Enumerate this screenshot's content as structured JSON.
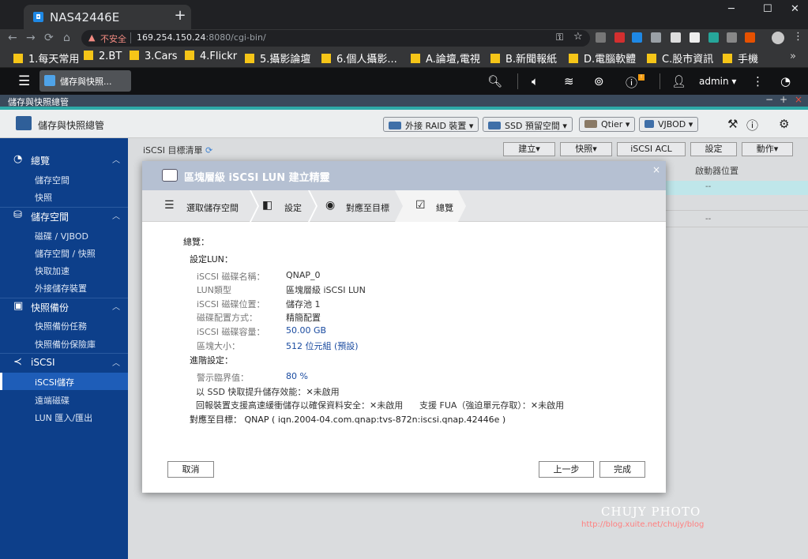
{
  "browser": {
    "tab_title": "NAS42446E",
    "tab_close": "×",
    "new_tab": "+",
    "window_controls": [
      "─",
      "☐",
      "✕"
    ],
    "insecure_label": "不安全",
    "url_host": "169.254.150.24",
    "url_rest": ":8080/cgi-bin/",
    "bookmarks": [
      "1.每天常用",
      "2.BT",
      "3.Cars",
      "4.Flickr",
      "5.攝影論壇",
      "6.個人攝影...",
      "A.論壇,電視",
      "B.新聞報紙",
      "D.電腦軟體",
      "C.股市資訊",
      "手機"
    ],
    "more": "»"
  },
  "qts": {
    "app_tab": "儲存與快照...",
    "info_badge": "!",
    "user": "admin"
  },
  "app": {
    "window_title": "儲存與快照總管",
    "title": "儲存與快照總管",
    "window_ctrls": [
      "−",
      "+",
      "×"
    ],
    "header_buttons": [
      "外接 RAID 裝置",
      "SSD 預留空間",
      "Qtier",
      "VJBOD"
    ]
  },
  "sidebar": {
    "sections": [
      {
        "label": "總覽",
        "items": [
          "儲存空間",
          "快照"
        ]
      },
      {
        "label": "儲存空間",
        "items": [
          "磁碟 / VJBOD",
          "儲存空間 / 快照",
          "快取加速",
          "外接儲存裝置"
        ]
      },
      {
        "label": "快照備份",
        "items": [
          "快照備份任務",
          "快照備份保險庫"
        ]
      },
      {
        "label": "iSCSI",
        "items": [
          "iSCSI儲存",
          "遠端磁碟",
          "LUN 匯入/匯出"
        ]
      }
    ]
  },
  "main": {
    "title": "iSCSI 目標清單",
    "toolbar": [
      "建立▾",
      "快照▾",
      "iSCSI ACL",
      "設定",
      "動作▾"
    ],
    "column_header": "啟動器位置",
    "dashes": [
      "--",
      "--"
    ]
  },
  "wizard": {
    "title": "區塊層級 iSCSI LUN 建立精靈",
    "steps": [
      "選取儲存空間",
      "設定",
      "對應至目標",
      "總覽"
    ],
    "summary_heading": "總覽：",
    "lun_heading": "設定LUN：",
    "lun_fields": [
      {
        "label": "iSCSI 磁碟名稱：",
        "value": "QNAP_0"
      },
      {
        "label": "LUN類型",
        "value": "區塊層級 iSCSI LUN"
      },
      {
        "label": "iSCSI 磁碟位置：",
        "value": "儲存池 1"
      },
      {
        "label": "磁碟配置方式：",
        "value": "精簡配置"
      },
      {
        "label": "iSCSI 磁碟容量：",
        "value": "50.00 GB"
      },
      {
        "label": "區塊大小：",
        "value": "512 位元組 (預設)"
      }
    ],
    "advanced_heading": "進階設定：",
    "threshold_label": "警示臨界值：",
    "threshold_value": "80 %",
    "ssd_cache_label": "以 SSD 快取提升儲存效能：",
    "ssd_cache_value": "未啟用",
    "report_label": "回報裝置支援高速緩衝儲存以確保資料安全：",
    "report_value": "未啟用",
    "fua_label": "支援 FUA（強迫單元存取）：",
    "fua_value": "未啟用",
    "map_label": "對應至目標：",
    "map_value": "QNAP ( iqn.2004-04.com.qnap:tvs-872n:iscsi.qnap.42446e )",
    "cancel": "取消",
    "back": "上一步",
    "finish": "完成",
    "close": "×"
  },
  "watermark": {
    "line1": "CHUJY PHOTO",
    "line2": "http://blog.xuite.net/chujy/blog"
  }
}
